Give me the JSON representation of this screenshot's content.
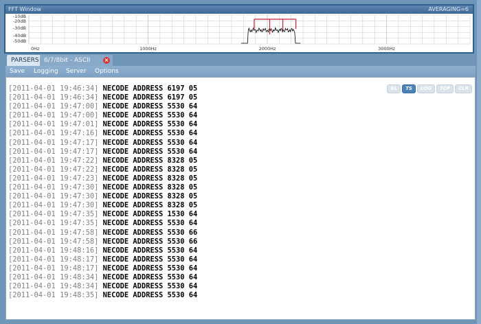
{
  "fft": {
    "title": "FFT Window",
    "averaging": "AVERAGING=6",
    "y_labels": [
      "-10dB",
      "-20dB",
      "-30dB",
      "-40dB",
      "-50dB"
    ],
    "x_labels": [
      "0Hz",
      "1000Hz",
      "2000Hz",
      "3000Hz"
    ],
    "colors": {
      "grid": "#c8c8c8",
      "trace": "#000000",
      "marker": "#c0203a"
    }
  },
  "tabs": {
    "parsers": "PARSERS",
    "active": "6/7/8bit - ASCII"
  },
  "menu": [
    "Save",
    "Logging",
    "Server",
    "Options"
  ],
  "toggles": [
    {
      "label": "BL",
      "active": false
    },
    {
      "label": "TS",
      "active": true
    },
    {
      "label": "LOG",
      "active": false
    },
    {
      "label": "TCP",
      "active": false
    },
    {
      "label": "CLR",
      "active": false
    }
  ],
  "log_lines": [
    {
      "ts": "[2011-04-01 19:46:34]",
      "msg": "NECODE ADDRESS 6197 05"
    },
    {
      "ts": "[2011-04-01 19:46:34]",
      "msg": "NECODE ADDRESS 6197 05"
    },
    {
      "ts": "[2011-04-01 19:47:00]",
      "msg": "NECODE ADDRESS 5530 64"
    },
    {
      "ts": "[2011-04-01 19:47:00]",
      "msg": "NECODE ADDRESS 5530 64"
    },
    {
      "ts": "[2011-04-01 19:47:01]",
      "msg": "NECODE ADDRESS 5530 64"
    },
    {
      "ts": "[2011-04-01 19:47:16]",
      "msg": "NECODE ADDRESS 5530 64"
    },
    {
      "ts": "[2011-04-01 19:47:17]",
      "msg": "NECODE ADDRESS 5530 64"
    },
    {
      "ts": "[2011-04-01 19:47:17]",
      "msg": "NECODE ADDRESS 5530 64"
    },
    {
      "ts": "[2011-04-01 19:47:22]",
      "msg": "NECODE ADDRESS 8328 05"
    },
    {
      "ts": "[2011-04-01 19:47:22]",
      "msg": "NECODE ADDRESS 8328 05"
    },
    {
      "ts": "[2011-04-01 19:47:23]",
      "msg": "NECODE ADDRESS 8328 05"
    },
    {
      "ts": "[2011-04-01 19:47:30]",
      "msg": "NECODE ADDRESS 8328 05"
    },
    {
      "ts": "[2011-04-01 19:47:30]",
      "msg": "NECODE ADDRESS 8328 05"
    },
    {
      "ts": "[2011-04-01 19:47:30]",
      "msg": "NECODE ADDRESS 8328 05"
    },
    {
      "ts": "[2011-04-01 19:47:35]",
      "msg": "NECODE ADDRESS 1530 64"
    },
    {
      "ts": "[2011-04-01 19:47:35]",
      "msg": "NECODE ADDRESS 5530 64"
    },
    {
      "ts": "[2011-04-01 19:47:58]",
      "msg": "NECODE ADDRESS 5530 66"
    },
    {
      "ts": "[2011-04-01 19:47:58]",
      "msg": "NECODE ADDRESS 5530 66"
    },
    {
      "ts": "[2011-04-01 19:48:16]",
      "msg": "NECODE ADDRESS 5530 64"
    },
    {
      "ts": "[2011-04-01 19:48:17]",
      "msg": "NECODE ADDRESS 5530 64"
    },
    {
      "ts": "[2011-04-01 19:48:17]",
      "msg": "NECODE ADDRESS 5530 64"
    },
    {
      "ts": "[2011-04-01 19:48:34]",
      "msg": "NECODE ADDRESS 5530 64"
    },
    {
      "ts": "[2011-04-01 19:48:34]",
      "msg": "NECODE ADDRESS 5530 64"
    },
    {
      "ts": "[2011-04-01 19:48:35]",
      "msg": "NECODE ADDRESS 5530 64"
    }
  ]
}
